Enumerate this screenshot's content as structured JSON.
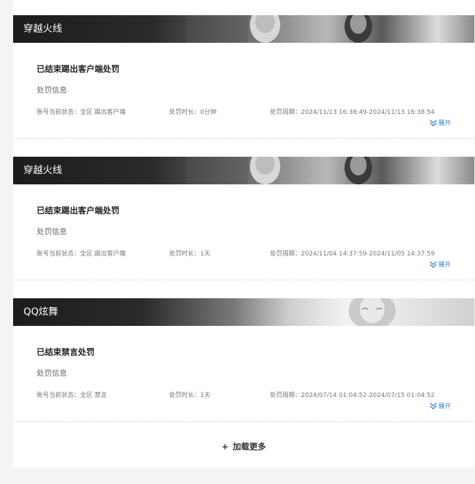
{
  "colors": {
    "link": "#2d7fe0",
    "banner_dark": "#1c1c1c"
  },
  "records": [
    {
      "game": "穿越火线",
      "status_title": "已结束踢出客户端处罚",
      "info_label": "处罚信息",
      "account_status": "账号当前状态：全区 踢出客户端",
      "duration": "处罚时长：0分钟",
      "period": "处罚周期：2024/11/13 16:38:49-2024/11/13 16:38:54",
      "expand_label": "展开"
    },
    {
      "game": "穿越火线",
      "status_title": "已结束踢出客户端处罚",
      "info_label": "处罚信息",
      "account_status": "账号当前状态：全区 踢出客户端",
      "duration": "处罚时长：1天",
      "period": "处罚周期：2024/11/04 14:37:59-2024/11/05 14:37:59",
      "expand_label": "展开"
    },
    {
      "game": "QQ炫舞",
      "status_title": "已结束禁言处罚",
      "info_label": "处罚信息",
      "account_status": "账号当前状态：全区 禁言",
      "duration": "处罚时长：1天",
      "period": "处罚周期：2024/07/14 01:04:52-2024/07/15 01:04:52",
      "expand_label": "展开"
    }
  ],
  "load_more": {
    "icon": "+",
    "label": "加载更多"
  }
}
